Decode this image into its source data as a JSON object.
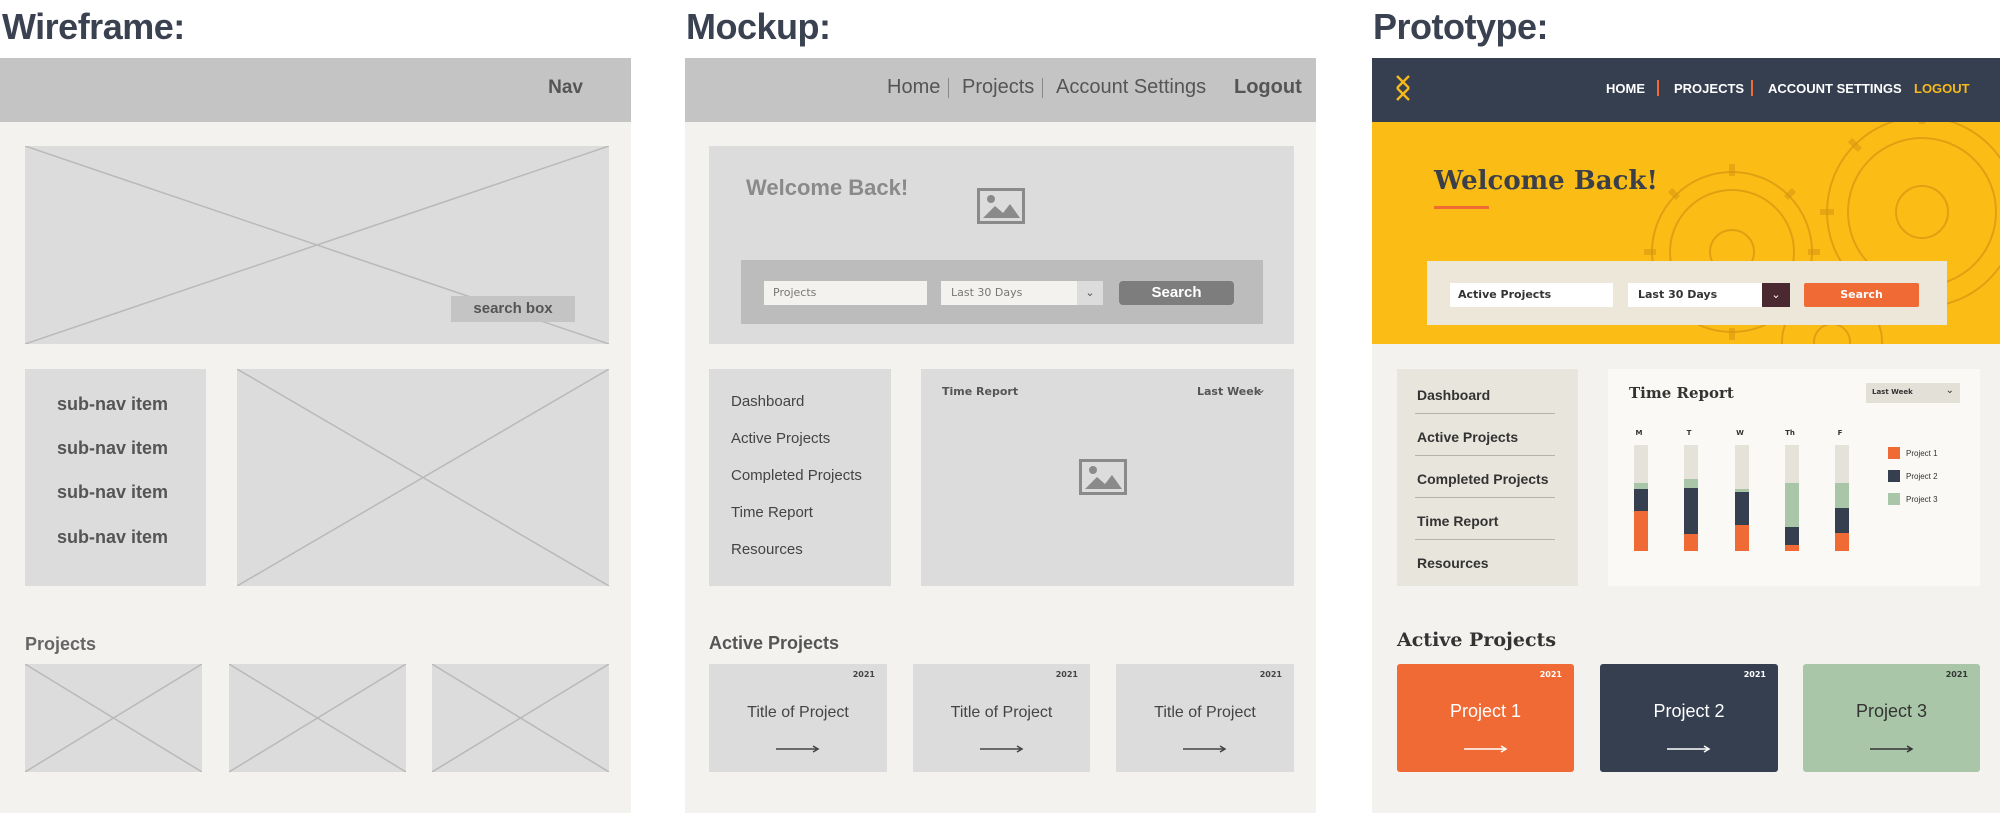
{
  "titles": {
    "wireframe": "Wireframe:",
    "mockup": "Mockup:",
    "prototype": "Prototype:"
  },
  "wireframe": {
    "nav": "Nav",
    "search_box": "search box",
    "subnav": [
      "sub-nav item",
      "sub-nav item",
      "sub-nav item",
      "sub-nav item"
    ],
    "projects_heading": "Projects"
  },
  "mockup": {
    "nav": {
      "home": "Home",
      "projects": "Projects",
      "account": "Account Settings",
      "logout": "Logout"
    },
    "hero_title": "Welcome Back!",
    "search": {
      "projects_placeholder": "Projects",
      "range": "Last 30 Days",
      "button": "Search"
    },
    "sidebar": [
      "Dashboard",
      "Active Projects",
      "Completed Projects",
      "Time Report",
      "Resources"
    ],
    "report": {
      "title": "Time Report",
      "range": "Last Week"
    },
    "section_title": "Active Projects",
    "cards": [
      {
        "year": "2021",
        "title": "Title of Project"
      },
      {
        "year": "2021",
        "title": "Title of Project"
      },
      {
        "year": "2021",
        "title": "Title of Project"
      }
    ]
  },
  "prototype": {
    "nav": {
      "home": "HOME",
      "projects": "PROJECTS",
      "account": "ACCOUNT SETTINGS",
      "logout": "LOGOUT"
    },
    "hero_title": "Welcome Back!",
    "search": {
      "projects_value": "Active Projects",
      "range": "Last 30 Days",
      "button": "Search"
    },
    "sidebar": [
      "Dashboard",
      "Active Projects",
      "Completed Projects",
      "Time Report",
      "Resources"
    ],
    "report": {
      "title": "Time Report",
      "range": "Last Week"
    },
    "chart": {
      "days": [
        "M",
        "T",
        "W",
        "Th",
        "F"
      ],
      "series": [
        {
          "name": "Project 1",
          "color": "#f06a35"
        },
        {
          "name": "Project 2",
          "color": "#353f50"
        },
        {
          "name": "Project 3",
          "color": "#a9c7a8"
        }
      ]
    },
    "section_title": "Active Projects",
    "cards": [
      {
        "year": "2021",
        "title": "Project 1",
        "color": "#f06a35"
      },
      {
        "year": "2021",
        "title": "Project 2",
        "color": "#353f50"
      },
      {
        "year": "2021",
        "title": "Project 3",
        "color": "#a9c7a8"
      }
    ]
  }
}
